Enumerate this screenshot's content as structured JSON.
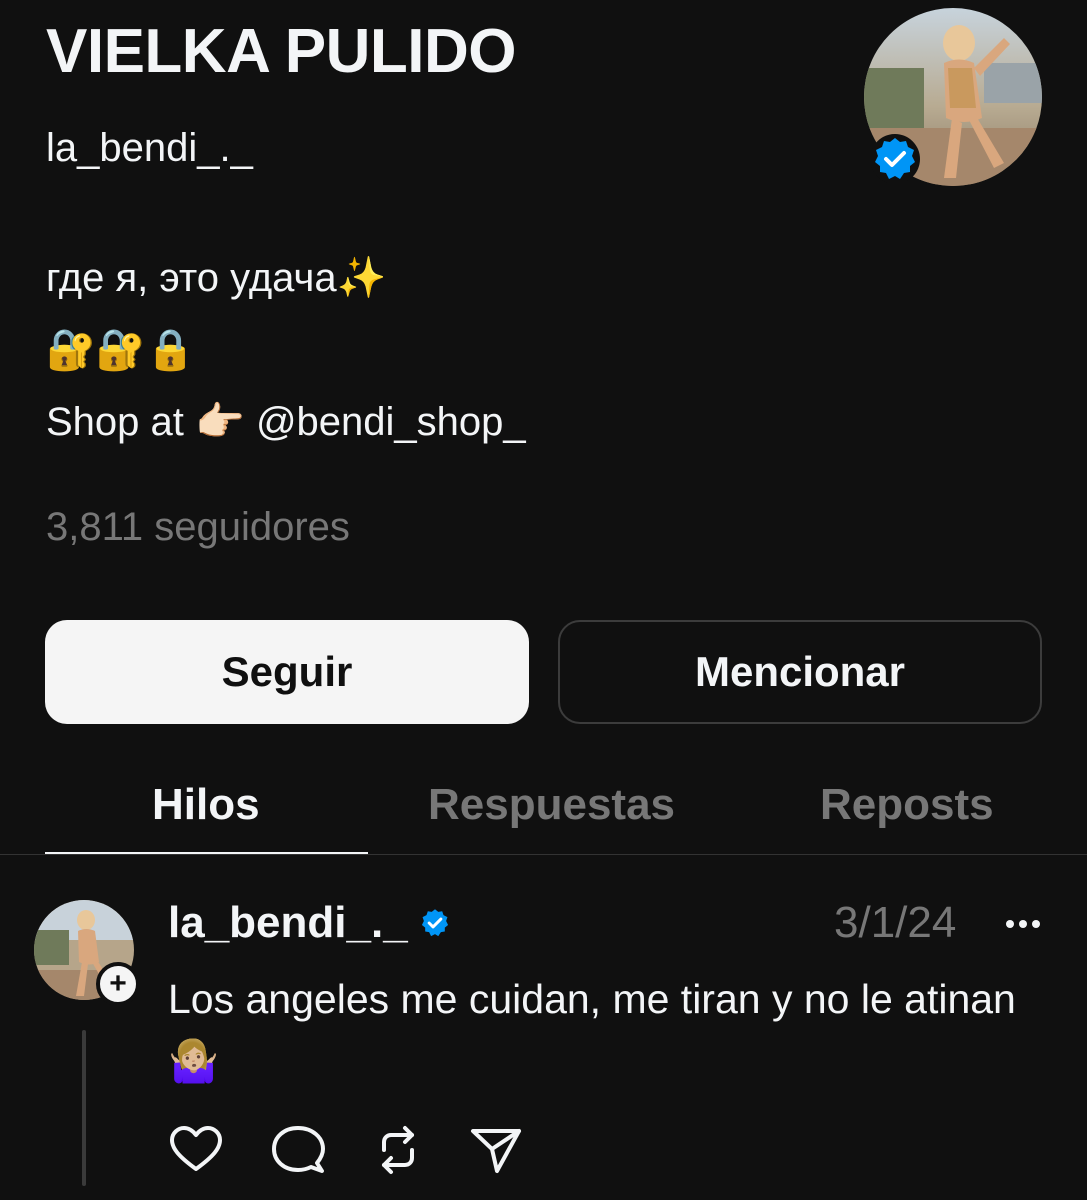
{
  "profile": {
    "name": "VIELKA PULIDO",
    "username": "la_bendi_._",
    "bio_line1": "где я, это удача",
    "bio_line1_emoji": "✨",
    "bio_line2_emoji": "🔐🔐🔒",
    "bio_line3_prefix": "Shop at",
    "bio_line3_emoji": "👉🏻",
    "bio_line3_link": "@bendi_shop_",
    "followers": "3,811 seguidores"
  },
  "buttons": {
    "follow": "Seguir",
    "mention": "Mencionar"
  },
  "tabs": [
    {
      "label": "Hilos",
      "active": true
    },
    {
      "label": "Respuestas",
      "active": false
    },
    {
      "label": "Reposts",
      "active": false
    }
  ],
  "post": {
    "username": "la_bendi_._",
    "date": "3/1/24",
    "text": "Los angeles me cuidan, me tiran y no le atinan",
    "text_emoji": "🤷🏼‍♀️",
    "follow_badge": "+"
  },
  "icons": {
    "verified": "verified-badge-icon",
    "more": "more-options-icon",
    "like": "heart-icon",
    "reply": "comment-icon",
    "repost": "repost-icon",
    "share": "send-icon"
  },
  "colors": {
    "background": "#101010",
    "text": "#f3f5f7",
    "muted": "#777777",
    "verified": "#0095f6"
  }
}
